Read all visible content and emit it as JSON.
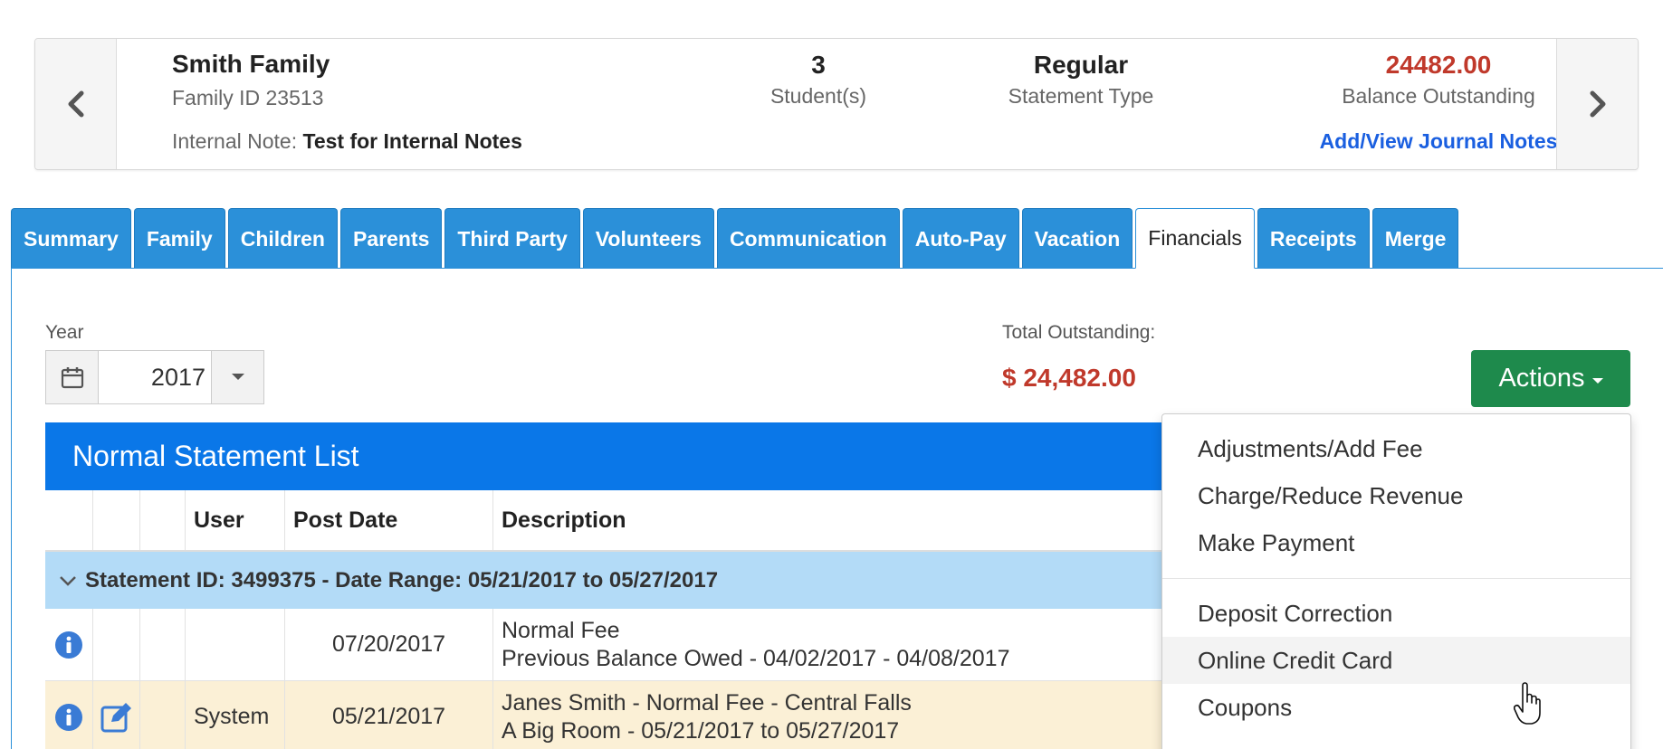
{
  "family": {
    "name": "Smith Family",
    "id_text": "Family ID 23513",
    "note_label": "Internal Note:",
    "note_value": "Test for Internal Notes",
    "students_count": "3",
    "students_label": "Student(s)",
    "statement_type": "Regular",
    "statement_type_label": "Statement Type",
    "balance": "24482.00",
    "balance_label": "Balance Outstanding",
    "journal_link": "Add/View Journal Notes"
  },
  "tabs": [
    {
      "label": "Summary"
    },
    {
      "label": "Family"
    },
    {
      "label": "Children"
    },
    {
      "label": "Parents"
    },
    {
      "label": "Third Party"
    },
    {
      "label": "Volunteers"
    },
    {
      "label": "Communication"
    },
    {
      "label": "Auto-Pay"
    },
    {
      "label": "Vacation"
    },
    {
      "label": "Financials",
      "active": true
    },
    {
      "label": "Receipts"
    },
    {
      "label": "Merge"
    }
  ],
  "filters": {
    "year_label": "Year",
    "year_value": "2017",
    "total_label": "Total Outstanding:",
    "total_value": "$ 24,482.00",
    "actions_label": "Actions"
  },
  "statement_list": {
    "title": "Normal Statement List",
    "columns": [
      "",
      "",
      "",
      "User",
      "Post Date",
      "Description"
    ],
    "group_label": "Statement ID: 3499375 - Date Range: 05/21/2017 to 05/27/2017",
    "rows": [
      {
        "user": "",
        "post_date": "07/20/2017",
        "desc_line1": "Normal Fee",
        "desc_line2": "Previous Balance Owed - 04/02/2017 - 04/08/2017",
        "editable": false
      },
      {
        "user": "System",
        "post_date": "05/21/2017",
        "desc_line1": "Janes Smith - Normal Fee - Central Falls",
        "desc_line2": "A Big Room - 05/21/2017 to 05/27/2017",
        "editable": true
      }
    ]
  },
  "actions_menu": {
    "items_group1": [
      "Adjustments/Add Fee",
      "Charge/Reduce Revenue",
      "Make Payment"
    ],
    "items_group2": [
      "Deposit Correction",
      "Online Credit Card",
      "Coupons"
    ],
    "hovered": "Online Credit Card"
  },
  "colors": {
    "tab_blue": "#2b90d9",
    "list_header_blue": "#0a77e8",
    "actions_green": "#1e8a4c",
    "balance_red": "#c0392b",
    "group_row_blue": "#b3dbf7",
    "alt_row_cream": "#fbf0d6"
  }
}
